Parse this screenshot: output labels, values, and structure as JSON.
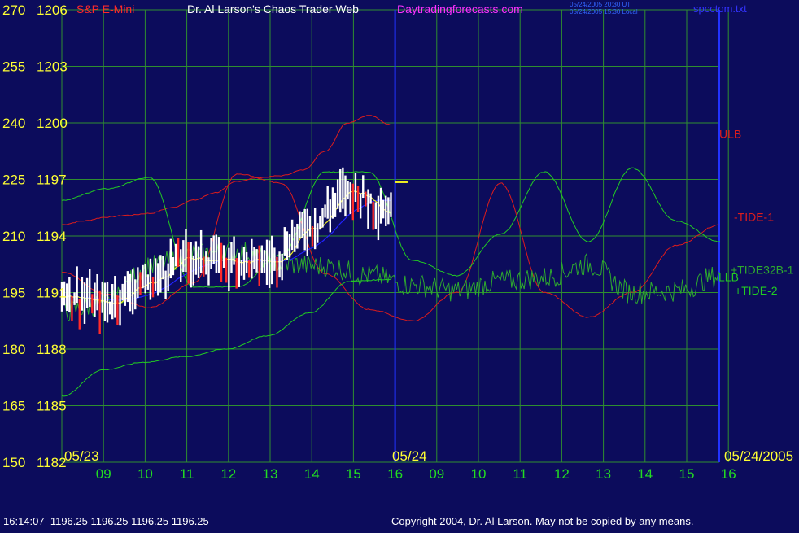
{
  "header": {
    "symbol": "S&P E-Mini",
    "title": "Dr. Al Larson's Chaos Trader Web",
    "site": "Daytradingforecasts.com",
    "timestamp_ut": "05/24/2005 20:30 UT",
    "timestamp_local": "05/24/2005 15:30 Local",
    "file": "spcctom.txt"
  },
  "footer": {
    "quote": "16:14:07  1196.25 1196.25 1196.25 1196.25",
    "copyright": "Copyright 2004, Dr. Al Larson. May not be copied by any means."
  },
  "colors": {
    "background": "#0c0c5c",
    "grid": "#2f8f2f",
    "axis_label": "#ffff33",
    "time_label": "#22dd22",
    "price_bar_up": "#ffffff",
    "price_bar_down": "#ff2a2a",
    "ulb": "#dd1c1c",
    "tide1": "#dd1c1c",
    "tide2": "#22cc22",
    "tide32b": "#2eaa2e",
    "llb": "#22cc22",
    "ma_fast": "#2222ff",
    "ma_slow": "#eeee22",
    "divider": "#2233ff",
    "title_text": "#ffffff",
    "site_text": "#ff33ff",
    "file_text": "#3333ff",
    "symbol_text": "#ff2a2a",
    "footer_text": "#ffffff"
  },
  "chart_data": {
    "type": "line",
    "y_tide_ticks": [
      "270",
      "255",
      "240",
      "225",
      "210",
      "195",
      "180",
      "165",
      "150"
    ],
    "y_price_ticks": [
      "1206",
      "1203",
      "1200",
      "1197",
      "1194",
      "1191",
      "1188",
      "1185",
      "1182"
    ],
    "y_price_range": [
      1182,
      1206
    ],
    "x_hours": [
      "09",
      "10",
      "11",
      "12",
      "13",
      "14",
      "15",
      "16",
      "09",
      "10",
      "11",
      "12",
      "13",
      "14",
      "15",
      "16"
    ],
    "date_labels": [
      "05/23",
      "05/24",
      "05/24/2005"
    ],
    "series": [
      {
        "name": "ULB",
        "values": [
          1194.6,
          1194.8,
          1195.0,
          1195.1,
          1195.2,
          1195.5,
          1195.9,
          1196.3,
          1196.9,
          1197.1,
          1197.2,
          1197.5,
          1198.5,
          1200.0,
          1200.4,
          1199.9
        ]
      },
      {
        "name": "-TIDE-1",
        "values": [
          1192.1,
          1190.9,
          1190.2,
          1191.5,
          1197.3,
          1196.8,
          1192.0,
          1190.1,
          1189.5,
          1191.0,
          1196.8,
          1191.0,
          1189.7,
          1191.0,
          1193.5,
          1194.6
        ]
      },
      {
        "name": "+TIDE32B-1",
        "values": [
          1190.0,
          1190.4,
          1192.4,
          1193.0,
          1193.2,
          1192.5,
          1192.4,
          1191.9,
          1191.4,
          1191.1,
          1191.6,
          1191.8,
          1192.5,
          1191.0,
          1191.1,
          1191.9
        ]
      },
      {
        "name": "+TIDE-2",
        "values": [
          1195.9,
          1196.5,
          1197.1,
          1191.3,
          1191.3,
          1193.0,
          1197.4,
          1197.4,
          1192.7,
          1191.9,
          1194.1,
          1197.4,
          1193.7,
          1197.6,
          1194.8,
          1193.7
        ]
      },
      {
        "name": "LLB",
        "values": [
          1185.5,
          1186.9,
          1187.3,
          1187.6,
          1188.0,
          1188.7,
          1189.9,
          1191.6,
          1191.7
        ]
      },
      {
        "name": "S&P E-Mini",
        "values": [
          1191.0,
          1190.4,
          1191.5,
          1192.8,
          1192.7,
          1192.6,
          1194.5,
          1196.4,
          1195.3
        ]
      }
    ],
    "last_price": 1196.25
  }
}
